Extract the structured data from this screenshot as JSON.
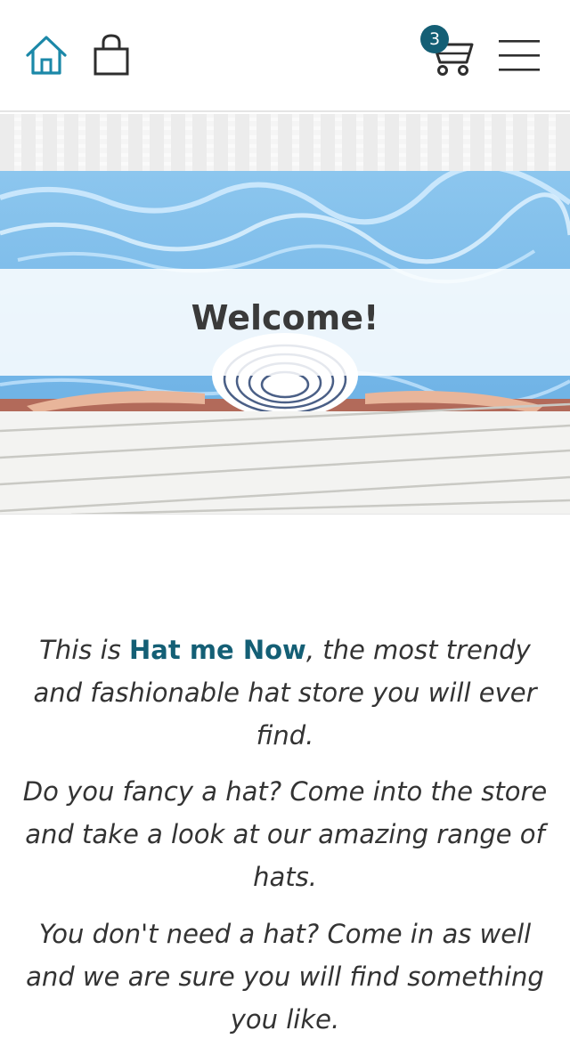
{
  "header": {
    "home_icon": "home-icon",
    "bag_icon": "shopping-bag-icon",
    "cart_icon": "shopping-cart-icon",
    "menu_icon": "hamburger-menu-icon",
    "cart_count": "3",
    "colors": {
      "accent": "#145f75",
      "home_icon": "#1b88a8",
      "icons": "#2e2e2e"
    }
  },
  "hero": {
    "title": "Welcome!"
  },
  "intro": {
    "p1_before": "This is ",
    "brand_name": "Hat me Now",
    "p1_after": ", the most trendy and fashionable hat store you will ever find.",
    "p2": "Do you fancy a hat? Come into the store and take a look at our amazing range of hats.",
    "p3": "You don't need a hat? Come in as well and we are sure you will find something you like."
  }
}
